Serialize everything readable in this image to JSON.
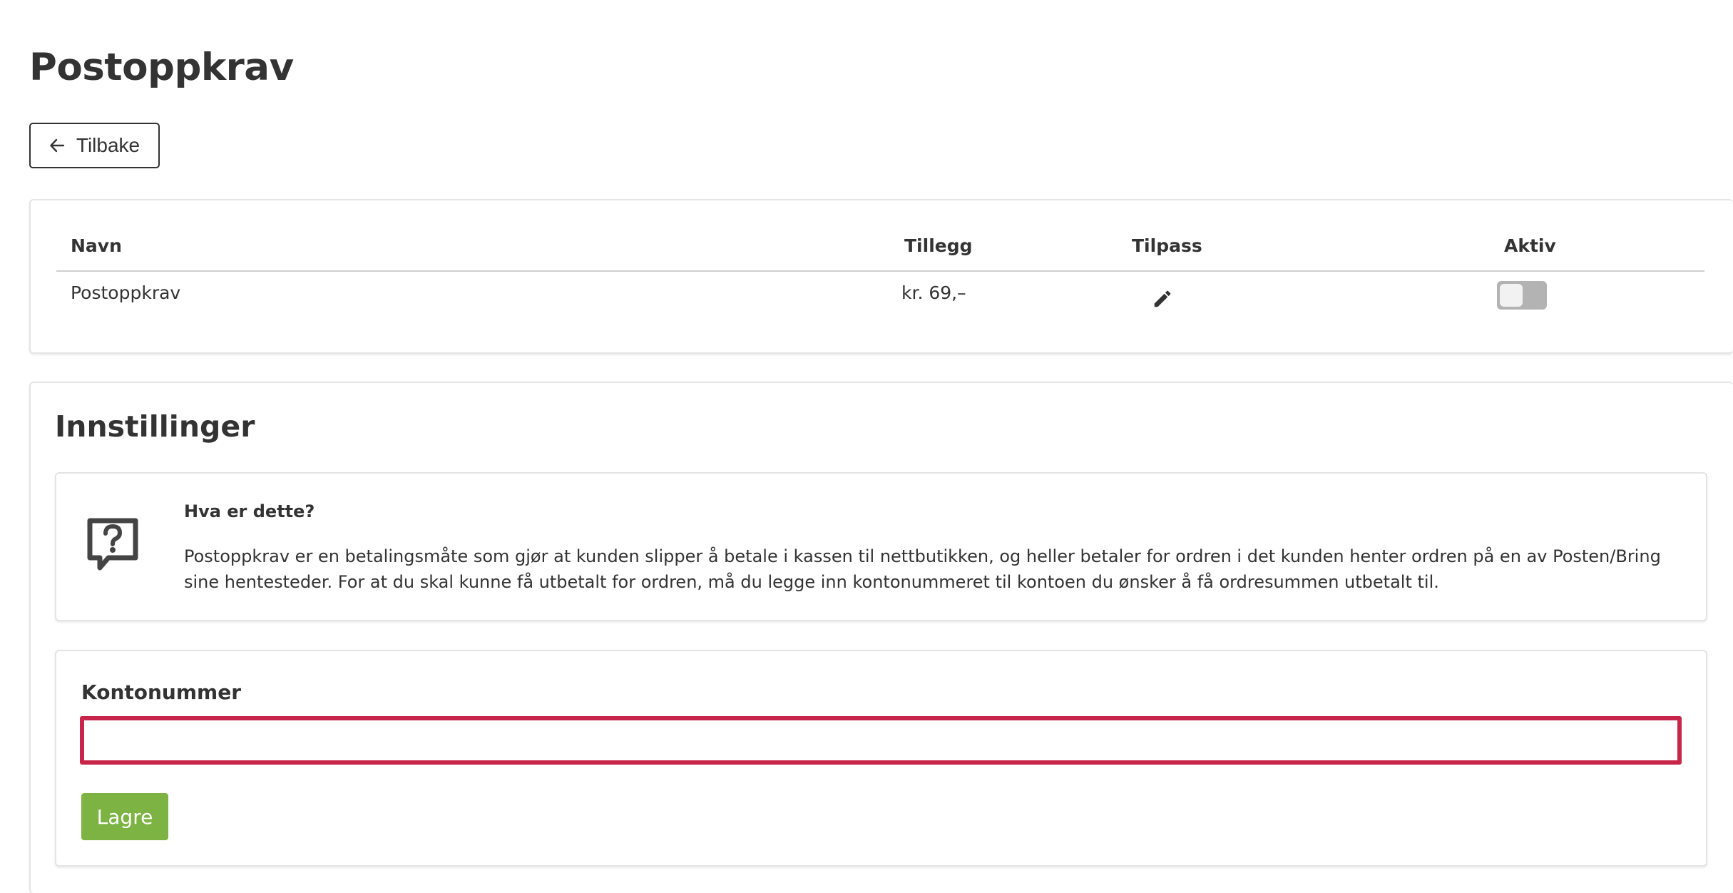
{
  "page": {
    "title": "Postoppkrav"
  },
  "back_button": {
    "label": "Tilbake",
    "icon": "arrow-left-icon"
  },
  "table": {
    "headers": {
      "name": "Navn",
      "fee": "Tillegg",
      "customize": "Tilpass",
      "active": "Aktiv"
    },
    "rows": [
      {
        "name": "Postoppkrav",
        "fee": "kr. 69,–",
        "customize_icon": "pencil-icon",
        "active": false
      }
    ]
  },
  "settings": {
    "title": "Innstillinger",
    "info": {
      "icon": "question-speech-bubble-icon",
      "title": "Hva er dette?",
      "text": "Postoppkrav er en betalingsmåte som gjør at kunden slipper å betale i kassen til nettbutikken, og heller betaler for ordren i det kunden henter ordren på en av Posten/Bring sine hentesteder. For at du skal kunne få utbetalt for ordren, må du legge inn kontonummeret til kontoen du ønsker å få ordresummen utbetalt til."
    },
    "form": {
      "account_label": "Kontonummer",
      "account_value": "",
      "save_label": "Lagre"
    }
  },
  "colors": {
    "text": "#333333",
    "error_border": "#c8254a",
    "save_button": "#7cb342",
    "toggle_off": "#b3b3b3",
    "card_border": "#e4e4e4"
  }
}
